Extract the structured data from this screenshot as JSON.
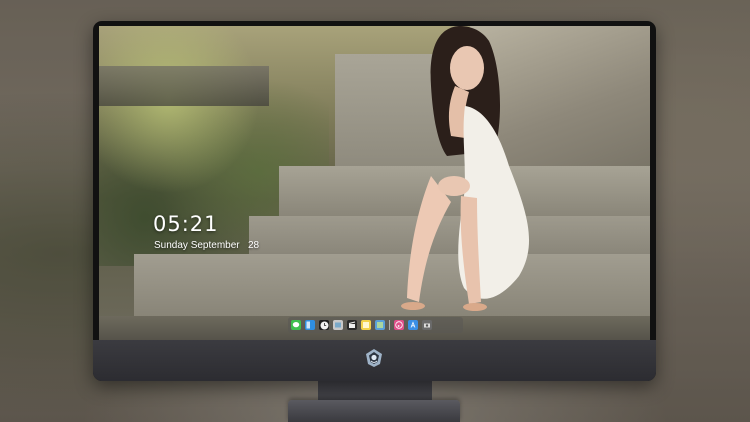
{
  "lockscreen": {
    "time": "05:21",
    "date": "Sunday September   28"
  },
  "dock": {
    "apps": [
      {
        "icon": "messages-icon",
        "color": "#3fbf4f"
      },
      {
        "icon": "finder-icon",
        "color": "#2f8ee0"
      },
      {
        "icon": "clock-icon",
        "color": "#e8e8e8"
      },
      {
        "icon": "photos-icon",
        "color": "#c9c9c9"
      },
      {
        "icon": "clapper-icon",
        "color": "#2a2a2a"
      },
      {
        "icon": "notes-icon",
        "color": "#f3d24a"
      },
      {
        "icon": "preview-icon",
        "color": "#5aa0d8"
      },
      {
        "icon": "itunes-icon",
        "color": "#e0508a"
      },
      {
        "icon": "app-store-icon",
        "color": "#3a8fe6"
      },
      {
        "icon": "camera-icon",
        "color": "#6a6a6a"
      }
    ]
  },
  "colors": {
    "monitor_body": "#111111",
    "chin": "#2c2c31",
    "clock_text": "#ffffff"
  }
}
